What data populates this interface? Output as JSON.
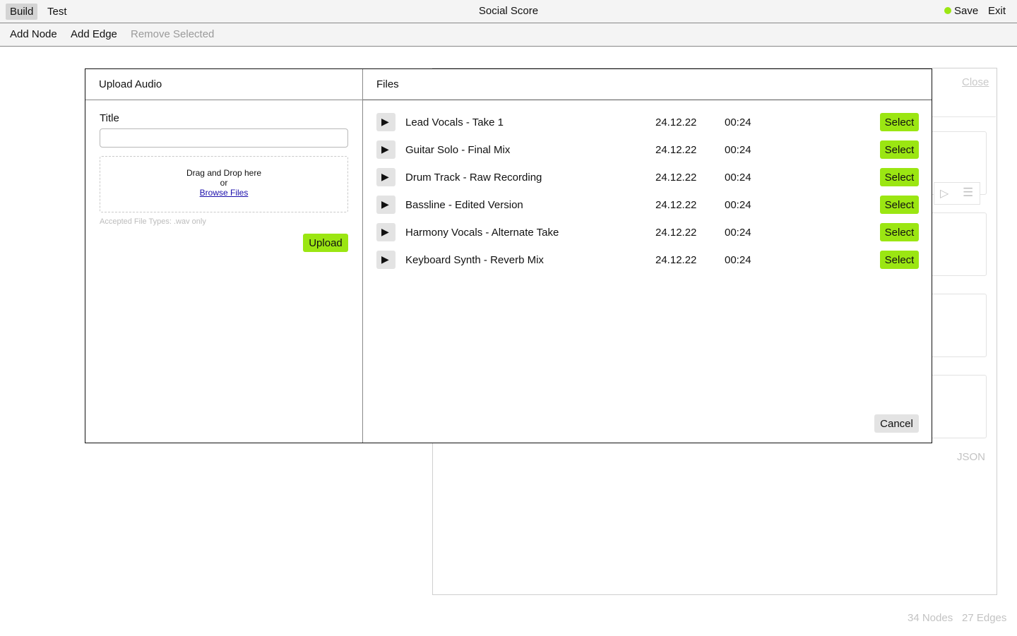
{
  "header": {
    "tabs": [
      "Build",
      "Test"
    ],
    "title": "Social Score",
    "save_label": "Save",
    "exit_label": "Exit",
    "status_color": "#9be612"
  },
  "toolbar": {
    "add_node": "Add Node",
    "add_edge": "Add Edge",
    "remove_selected": "Remove Selected"
  },
  "background_panel": {
    "close_label": "Close",
    "json_label": "JSON",
    "icons": [
      "play-outline-icon",
      "menu-icon"
    ]
  },
  "status_bar": {
    "nodes": "34 Nodes",
    "edges": "27 Edges"
  },
  "upload": {
    "heading": "Upload Audio",
    "title_label": "Title",
    "title_value": "",
    "drop_text": "Drag and Drop here",
    "or_text": "or",
    "browse_label": "Browse Files",
    "accepted_text": "Accepted File Types: .wav only",
    "upload_button": "Upload"
  },
  "files": {
    "heading": "Files",
    "select_label": "Select",
    "cancel_label": "Cancel",
    "items": [
      {
        "name": "Lead Vocals - Take 1",
        "date": "24.12.22",
        "duration": "00:24"
      },
      {
        "name": "Guitar Solo - Final Mix",
        "date": "24.12.22",
        "duration": "00:24"
      },
      {
        "name": "Drum Track - Raw Recording",
        "date": "24.12.22",
        "duration": "00:24"
      },
      {
        "name": "Bassline - Edited Version",
        "date": "24.12.22",
        "duration": "00:24"
      },
      {
        "name": "Harmony Vocals - Alternate Take",
        "date": "24.12.22",
        "duration": "00:24"
      },
      {
        "name": "Keyboard Synth - Reverb Mix",
        "date": "24.12.22",
        "duration": "00:24"
      }
    ]
  },
  "colors": {
    "accent": "#9be612",
    "muted_text": "#c3c3c3",
    "button_gray": "#e3e3e3"
  }
}
